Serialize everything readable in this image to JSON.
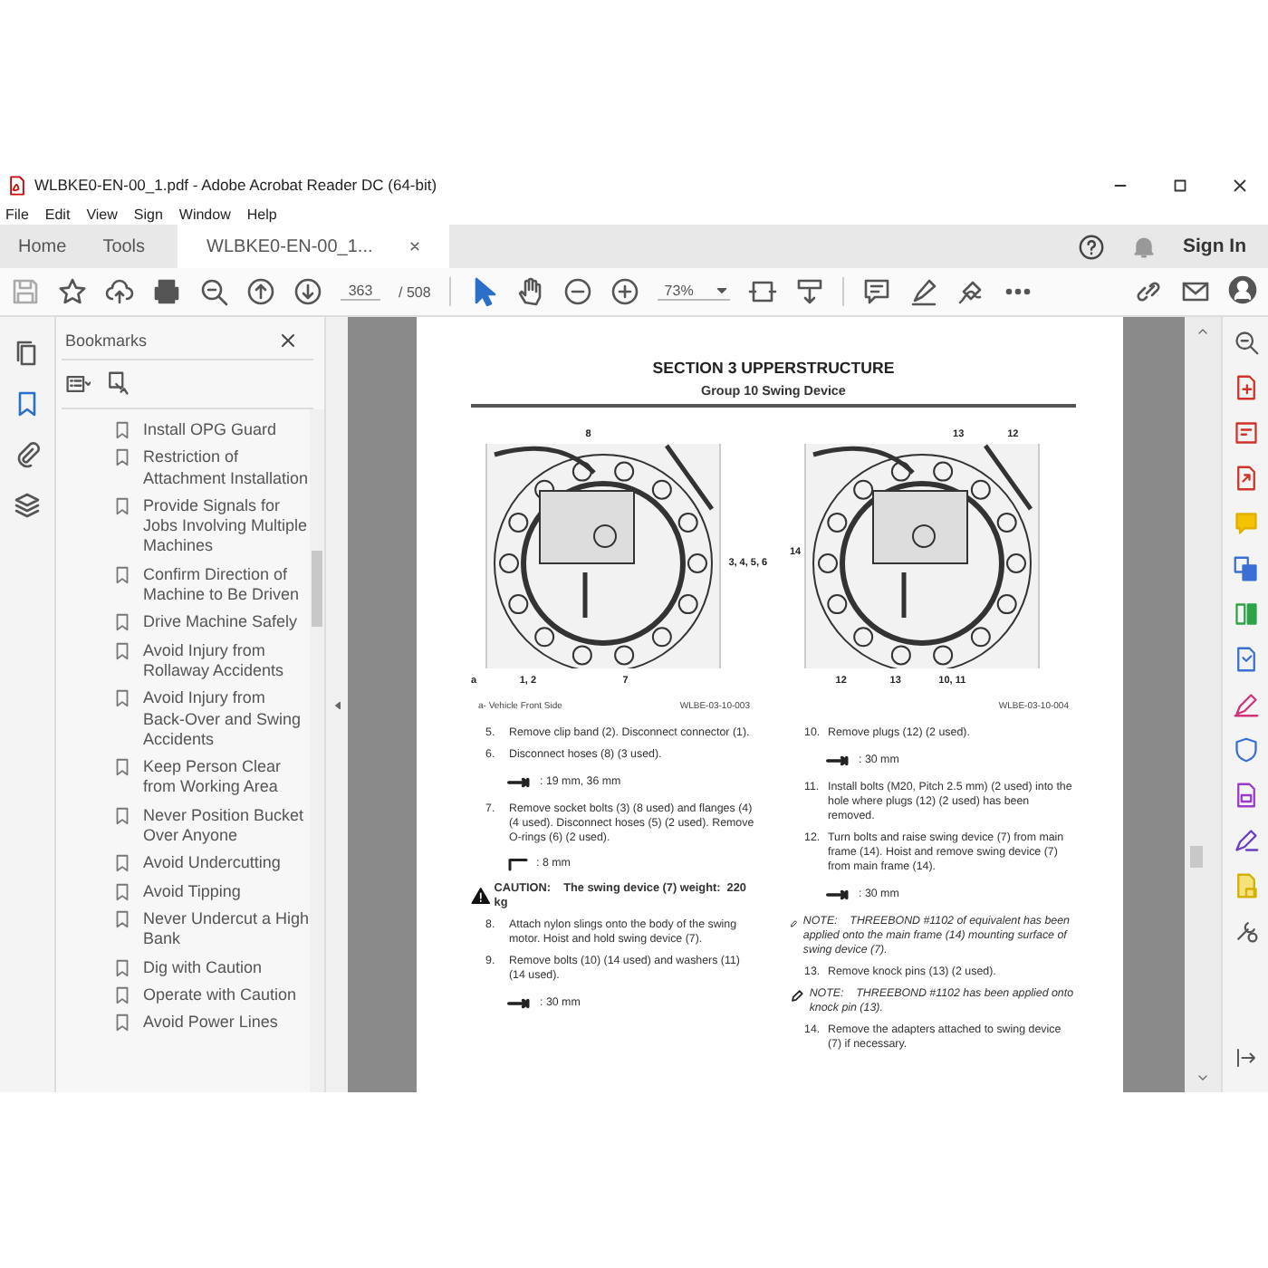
{
  "window": {
    "title": "WLBKE0-EN-00_1.pdf - Adobe Acrobat Reader DC (64-bit)"
  },
  "menu": [
    "File",
    "Edit",
    "View",
    "Sign",
    "Window",
    "Help"
  ],
  "tabs": [
    {
      "label": "Home",
      "selected": false
    },
    {
      "label": "Tools",
      "selected": false
    },
    {
      "label": "WLBKE0-EN-00_1...",
      "selected": true
    }
  ],
  "sign_in": "Sign In",
  "toolbar": {
    "page": "363",
    "page_count": "/ 508",
    "zoom": "73%"
  },
  "sidebar": {
    "title": "Bookmarks",
    "items": [
      {
        "label": "Install OPG Guard"
      },
      {
        "label": "Restriction of Attachment Installation"
      },
      {
        "label": "Provide Signals for Jobs Involving Multiple Machines"
      },
      {
        "label": "Confirm Direction of Machine to Be Driven"
      },
      {
        "label": "Drive Machine Safely"
      },
      {
        "label": "Avoid Injury from Rollaway Accidents"
      },
      {
        "label": "Avoid Injury from Back-Over and Swing Accidents"
      },
      {
        "label": "Keep Person Clear from Working Area"
      },
      {
        "label": "Never Position Bucket Over Anyone"
      },
      {
        "label": "Avoid Undercutting"
      },
      {
        "label": "Avoid Tipping"
      },
      {
        "label": "Never Undercut a High Bank"
      },
      {
        "label": "Dig with Caution"
      },
      {
        "label": "Operate with Caution"
      },
      {
        "label": "Avoid Power Lines"
      }
    ]
  },
  "page": {
    "section": "SECTION 3 UPPERSTRUCTURE",
    "group": "Group 10 Swing Device",
    "figures": [
      {
        "callouts": [
          "8",
          "3, 4, 5, 6",
          "a",
          "1, 2",
          "7"
        ],
        "legend": "a-  Vehicle Front Side",
        "code": "WLBE-03-10-003"
      },
      {
        "callouts": [
          "13",
          "12",
          "14",
          "12",
          "13",
          "10, 11"
        ],
        "code": "WLBE-03-10-004"
      }
    ],
    "columns": [
      [
        {
          "kind": "step",
          "number": "5.",
          "text": "Remove clip band (2). Disconnect connector (1)."
        },
        {
          "kind": "step",
          "number": "6.",
          "text": "Disconnect hoses (8) (3 used)."
        },
        {
          "kind": "wrench",
          "text": ": 19 mm, 36 mm"
        },
        {
          "kind": "step",
          "number": "7.",
          "text": "Remove socket bolts (3) (8 used) and flanges (4) (4 used). Disconnect hoses (5) (2 used). Remove O-rings (6) (2 used)."
        },
        {
          "kind": "hexkey",
          "text": ": 8 mm"
        },
        {
          "kind": "caution",
          "text": "CAUTION:    The swing device (7) weight:  220 kg"
        },
        {
          "kind": "step",
          "number": "8.",
          "text": "Attach nylon slings onto the body of the swing motor. Hoist and hold swing device (7)."
        },
        {
          "kind": "step",
          "number": "9.",
          "text": "Remove bolts (10) (14 used) and washers (11) (14 used)."
        },
        {
          "kind": "wrench",
          "text": ": 30 mm"
        }
      ],
      [
        {
          "kind": "step",
          "number": "10.",
          "text": "Remove plugs (12) (2 used)."
        },
        {
          "kind": "wrench",
          "text": ": 30 mm"
        },
        {
          "kind": "step",
          "number": "11.",
          "text": "Install bolts (M20, Pitch 2.5 mm) (2 used) into the hole where plugs (12) (2 used) has been removed."
        },
        {
          "kind": "step",
          "number": "12.",
          "text": "Turn bolts and raise swing device (7) from main frame (14). Hoist and remove swing device (7) from main frame (14)."
        },
        {
          "kind": "wrench",
          "text": ": 30 mm"
        },
        {
          "kind": "note",
          "text": "NOTE:    THREEBOND #1102 of equivalent has been applied onto the main frame (14) mounting surface of swing device (7)."
        },
        {
          "kind": "step",
          "number": "13.",
          "text": "Remove knock pins (13) (2 used)."
        },
        {
          "kind": "note",
          "text": "NOTE:    THREEBOND #1102 has been applied onto knock pin (13)."
        },
        {
          "kind": "step",
          "number": "14.",
          "text": "Remove the adapters attached to swing device (7) if necessary."
        }
      ]
    ]
  }
}
